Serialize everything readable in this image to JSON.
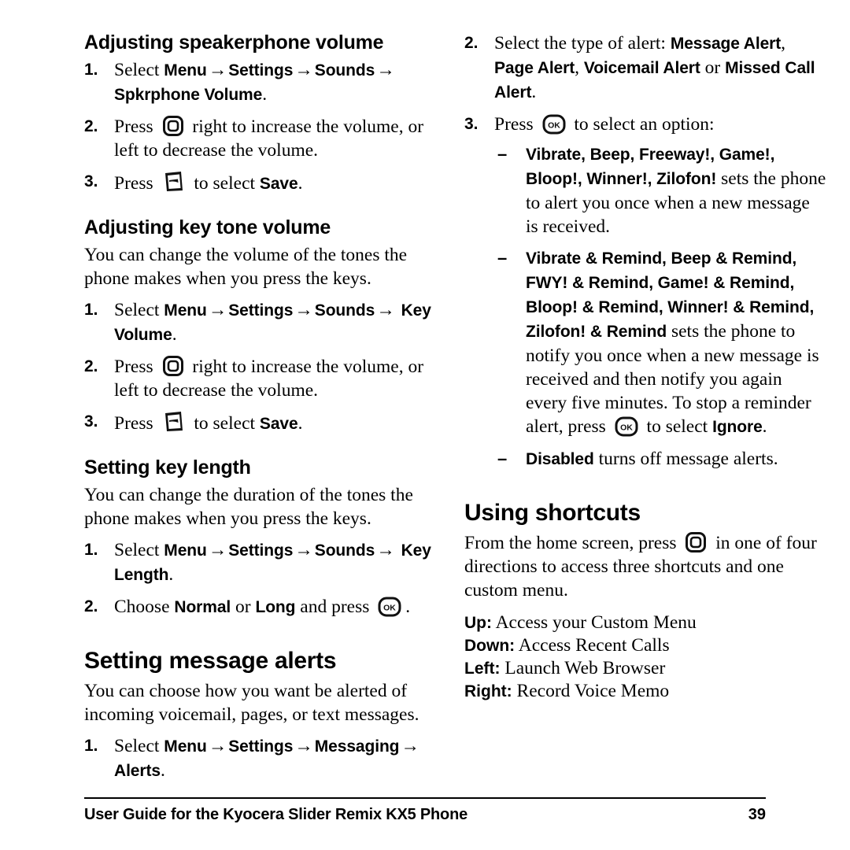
{
  "document": {
    "page_number": "39",
    "footer_text": "User Guide for the Kyocera Slider Remix KX5 Phone"
  },
  "icons": {
    "nav_key": "navigation-key-icon",
    "softkey": "left-softkey-icon",
    "ok_key": "ok-key-icon",
    "ok_label": "OK"
  },
  "left_column": {
    "section_speakerphone": {
      "heading": "Adjusting speakerphone volume",
      "steps": [
        {
          "number": "1.",
          "pre": "Select ",
          "path": [
            "Menu",
            "Settings",
            "Sounds",
            "Spkrphone Volume"
          ],
          "post": "."
        },
        {
          "number": "2.",
          "pre": "Press ",
          "icon": "nav-key",
          "post": " right to increase the volume, or left to decrease the volume."
        },
        {
          "number": "3.",
          "pre": "Press ",
          "icon": "softkey",
          "mid": " to select ",
          "bold": "Save",
          "post": "."
        }
      ]
    },
    "section_keytone": {
      "heading": "Adjusting key tone volume",
      "intro": "You can change the volume of the tones the phone makes when you press the keys.",
      "steps": [
        {
          "number": "1.",
          "pre": "Select ",
          "path": [
            "Menu",
            "Settings",
            "Sounds",
            "Key Volume"
          ],
          "post": "."
        },
        {
          "number": "2.",
          "pre": "Press ",
          "icon": "nav-key",
          "post": " right to increase the volume, or left to decrease the volume."
        },
        {
          "number": "3.",
          "pre": "Press ",
          "icon": "softkey",
          "mid": " to select ",
          "bold": "Save",
          "post": "."
        }
      ]
    },
    "section_keylength": {
      "heading": "Setting key length",
      "intro": "You can change the duration of the tones the phone makes when you press the keys.",
      "steps": [
        {
          "number": "1.",
          "pre": "Select ",
          "path": [
            "Menu",
            "Settings",
            "Sounds",
            "Key Length"
          ],
          "post": "."
        },
        {
          "number": "2.",
          "pre": "Choose ",
          "opt_a": "Normal",
          "mid": " or ",
          "opt_b": "Long",
          "mid2": " and press ",
          "icon": "ok-key",
          "post": "."
        }
      ]
    },
    "section_message_alerts": {
      "heading": "Setting message alerts",
      "intro": "You can choose how you want be alerted of incoming voicemail, pages, or text messages.",
      "steps": [
        {
          "number": "1.",
          "pre": "Select ",
          "path": [
            "Menu",
            "Settings",
            "Messaging",
            "Alerts"
          ],
          "post": "."
        }
      ]
    }
  },
  "right_column": {
    "step2": {
      "number": "2.",
      "pre": "Select the type of alert: ",
      "alert_1": "Message Alert",
      "sep_1": ", ",
      "alert_2": "Page Alert",
      "sep_2": ", ",
      "alert_3": "Voicemail Alert",
      "sep_3": " or ",
      "alert_4": "Missed Call Alert",
      "post": "."
    },
    "step3": {
      "number": "3.",
      "pre": "Press ",
      "icon": "ok-key",
      "post": " to select an option:"
    },
    "options": [
      {
        "dash": "–",
        "bold": "Vibrate, Beep, Freeway!, Game!, Bloop!, Winner!, Zilofon!",
        "text": " sets the phone to alert you once when a new message is received."
      },
      {
        "dash": "–",
        "bold": "Vibrate & Remind, Beep & Remind, FWY! & Remind, Game! & Remind, Bloop! & Remind, Winner! & Remind, Zilofon! & Remind",
        "text_a": " sets the phone to notify you once when a new message is received and then notify you again every five minutes. To stop a reminder alert, press ",
        "icon": "ok-key",
        "text_b": " to select ",
        "bold_b": "Ignore",
        "text_c": "."
      },
      {
        "dash": "–",
        "bold": "Disabled",
        "text": " turns off message alerts."
      }
    ],
    "section_shortcuts": {
      "heading": "Using shortcuts",
      "intro_a": "From the home screen, press ",
      "icon": "nav-key",
      "intro_b": " in one of four directions to access three shortcuts and one custom menu.",
      "directions": [
        {
          "dir": "Up:",
          "desc": " Access your Custom Menu"
        },
        {
          "dir": "Down:",
          "desc": " Access Recent Calls"
        },
        {
          "dir": "Left:",
          "desc": " Launch Web Browser"
        },
        {
          "dir": "Right:",
          "desc": " Record Voice Memo"
        }
      ]
    }
  }
}
